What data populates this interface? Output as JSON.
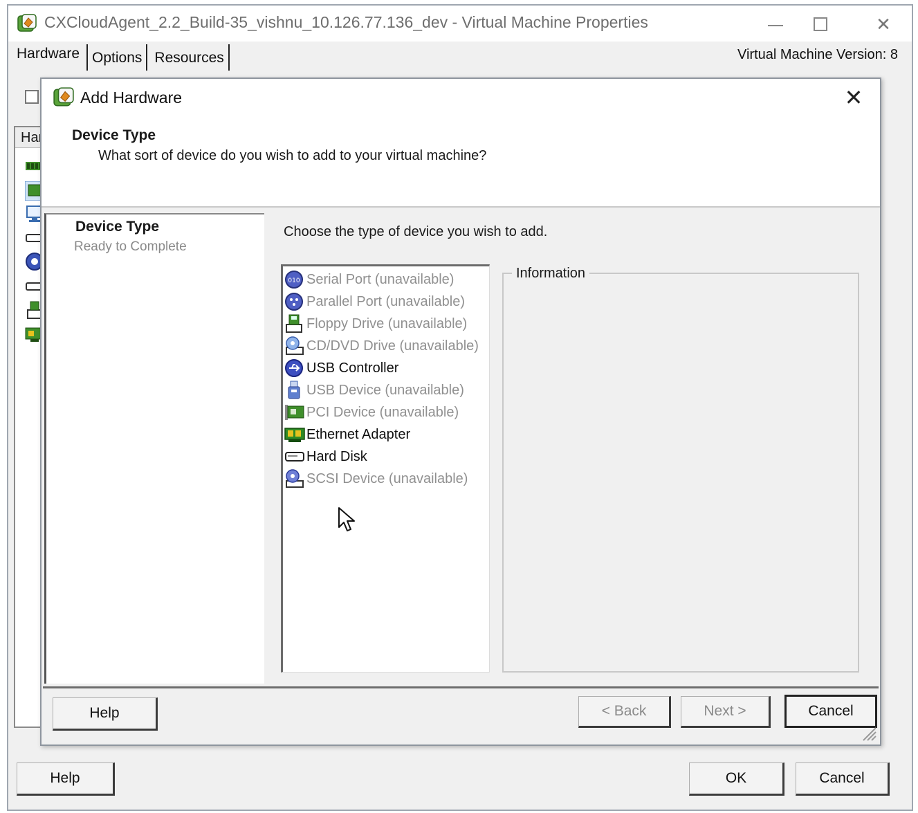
{
  "window": {
    "title": "CXCloudAgent_2.2_Build-35_vishnu_10.126.77.136_dev - Virtual Machine Properties",
    "close_glyph": "✕",
    "tabs": [
      "Hardware",
      "Options",
      "Resources"
    ],
    "vm_version": "Virtual Machine Version: 8",
    "table_header_partial": "Har",
    "help_label": "Help",
    "ok_label": "OK",
    "cancel_label": "Cancel"
  },
  "dialog": {
    "title": "Add Hardware",
    "close_glyph": "✕",
    "header": {
      "heading": "Device Type",
      "subheading": "What sort of device do you wish to add to your virtual machine?"
    },
    "steps": {
      "current": "Device Type",
      "next": "Ready to Complete"
    },
    "instruction": "Choose the type of device you wish to add.",
    "devices": [
      {
        "label": "Serial Port (unavailable)",
        "icon": "serial-port-icon",
        "available": false
      },
      {
        "label": "Parallel Port (unavailable)",
        "icon": "parallel-port-icon",
        "available": false
      },
      {
        "label": "Floppy Drive (unavailable)",
        "icon": "floppy-drive-icon",
        "available": false
      },
      {
        "label": "CD/DVD Drive (unavailable)",
        "icon": "cd-dvd-drive-icon",
        "available": false
      },
      {
        "label": "USB Controller",
        "icon": "usb-controller-icon",
        "available": true
      },
      {
        "label": "USB Device (unavailable)",
        "icon": "usb-device-icon",
        "available": false
      },
      {
        "label": "PCI Device (unavailable)",
        "icon": "pci-device-icon",
        "available": false
      },
      {
        "label": "Ethernet Adapter",
        "icon": "ethernet-adapter-icon",
        "available": true
      },
      {
        "label": "Hard Disk",
        "icon": "hard-disk-icon",
        "available": true
      },
      {
        "label": "SCSI Device (unavailable)",
        "icon": "scsi-device-icon",
        "available": false
      }
    ],
    "information_label": "Information",
    "buttons": {
      "help": "Help",
      "back": "< Back",
      "next": "Next >",
      "cancel": "Cancel"
    }
  },
  "colors": {
    "accent_orange": "#e08a1e",
    "vm_green": "#3f8f2b",
    "disabled_text": "#909090"
  }
}
